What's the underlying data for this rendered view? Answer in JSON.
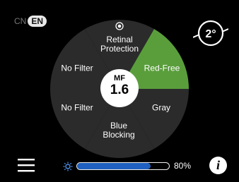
{
  "language": {
    "inactive": "CN",
    "active": "EN"
  },
  "zoom": {
    "label": "2°"
  },
  "segments": [
    {
      "id": "retinal",
      "lines": [
        "Retinal",
        "Protection"
      ],
      "icon": "target-icon"
    },
    {
      "id": "red-free",
      "lines": [
        "Red-Free"
      ],
      "selected": true
    },
    {
      "id": "gray",
      "lines": [
        "Gray"
      ]
    },
    {
      "id": "blue",
      "lines": [
        "Blue",
        "Blocking"
      ]
    },
    {
      "id": "no-filter-lower",
      "lines": [
        "No Filter"
      ]
    },
    {
      "id": "no-filter-upper",
      "lines": [
        "No Filter"
      ]
    }
  ],
  "center": {
    "label": "MF",
    "value": "1.6"
  },
  "brightness": {
    "level": 80,
    "text": "80%"
  },
  "info": {
    "label": "i"
  },
  "colors": {
    "wheel": "#2b2b2b",
    "selected": "#5a9e3c",
    "bar_fill": "#1e5fbf"
  },
  "icons": {
    "menu": "hamburger-icon",
    "brightness": "sun-icon",
    "zoom": "zoom-degree-icon"
  }
}
